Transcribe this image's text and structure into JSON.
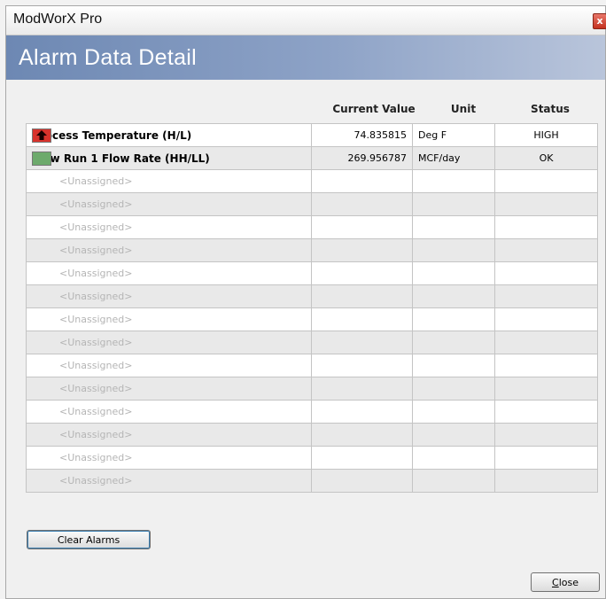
{
  "window": {
    "app_title": "ModWorX Pro",
    "close_glyph": "x",
    "header_title": "Alarm Data Detail"
  },
  "grid": {
    "columns": [
      "Current Value",
      "Unit",
      "Status"
    ],
    "rows": [
      {
        "name": "Process Temperature (H/L)",
        "value": "74.835815",
        "unit": "Deg F",
        "status": "HIGH",
        "indicator": "high-alarm-arrow-icon",
        "color": "#d8322c"
      },
      {
        "name": "Flow Run 1 Flow Rate (HH/LL)",
        "value": "269.956787",
        "unit": "MCF/day",
        "status": "OK",
        "indicator": "ok-status-icon",
        "color": "#6daa6c"
      },
      {
        "name": "<Unassigned>",
        "value": "",
        "unit": "",
        "status": ""
      },
      {
        "name": "<Unassigned>",
        "value": "",
        "unit": "",
        "status": ""
      },
      {
        "name": "<Unassigned>",
        "value": "",
        "unit": "",
        "status": ""
      },
      {
        "name": "<Unassigned>",
        "value": "",
        "unit": "",
        "status": ""
      },
      {
        "name": "<Unassigned>",
        "value": "",
        "unit": "",
        "status": ""
      },
      {
        "name": "<Unassigned>",
        "value": "",
        "unit": "",
        "status": ""
      },
      {
        "name": "<Unassigned>",
        "value": "",
        "unit": "",
        "status": ""
      },
      {
        "name": "<Unassigned>",
        "value": "",
        "unit": "",
        "status": ""
      },
      {
        "name": "<Unassigned>",
        "value": "",
        "unit": "",
        "status": ""
      },
      {
        "name": "<Unassigned>",
        "value": "",
        "unit": "",
        "status": ""
      },
      {
        "name": "<Unassigned>",
        "value": "",
        "unit": "",
        "status": ""
      },
      {
        "name": "<Unassigned>",
        "value": "",
        "unit": "",
        "status": ""
      },
      {
        "name": "<Unassigned>",
        "value": "",
        "unit": "",
        "status": ""
      },
      {
        "name": "<Unassigned>",
        "value": "",
        "unit": "",
        "status": ""
      }
    ]
  },
  "buttons": {
    "clear_alarms": "Clear Alarms",
    "close_mnemonic": "C",
    "close_rest": "lose"
  }
}
